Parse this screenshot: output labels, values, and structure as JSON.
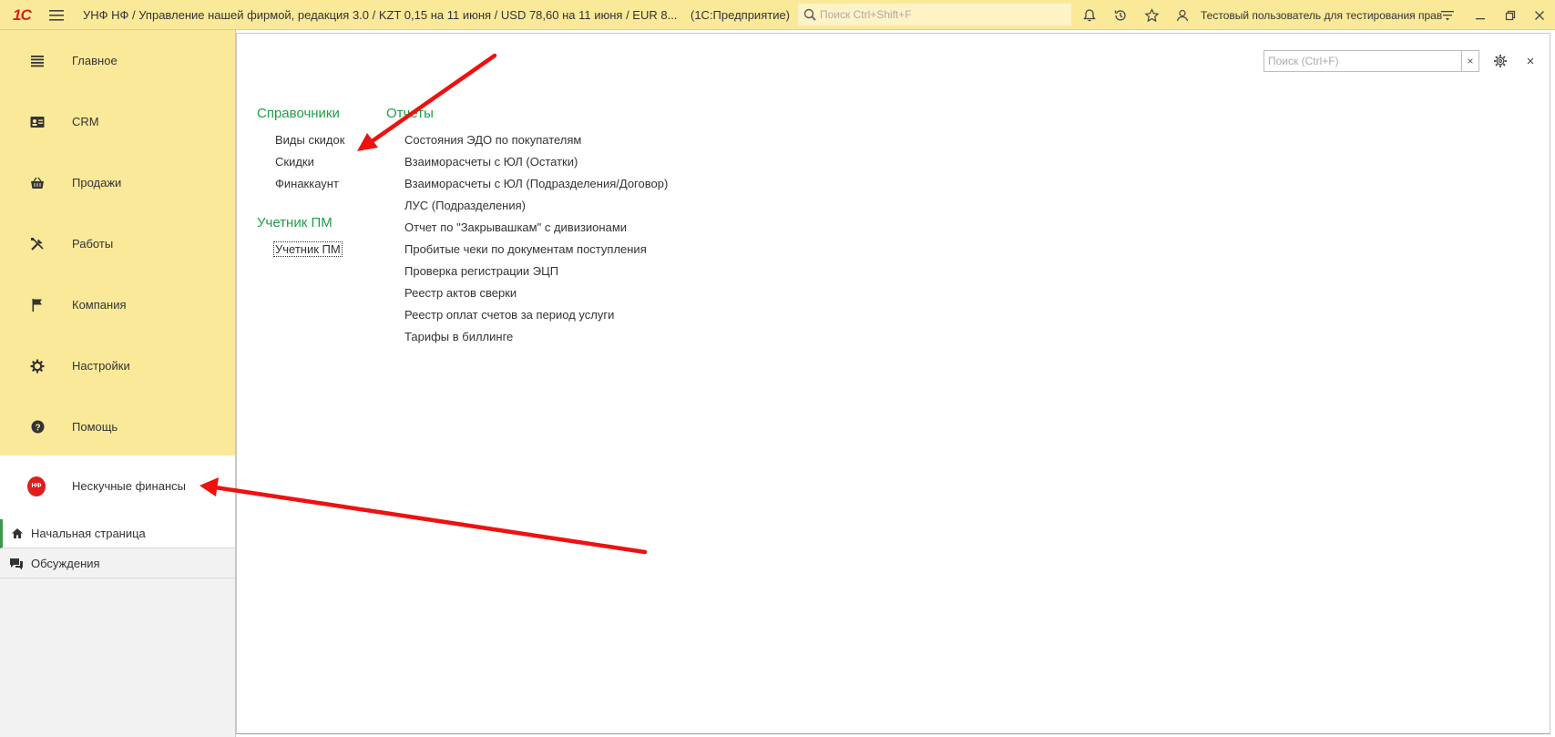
{
  "titlebar": {
    "logo": "1С",
    "title": "УНФ НФ / Управление нашей фирмой, редакция 3.0 / KZT 0,15 на 11 июня / USD 78,60 на 11 июня / EUR 8...",
    "platform": "(1С:Предприятие)",
    "search_placeholder": "Поиск Ctrl+Shift+F",
    "user": "Тестовый пользователь для тестирования прав"
  },
  "sidebar": {
    "sections": [
      {
        "label": "Главное",
        "icon": "main-menu-icon"
      },
      {
        "label": "CRM",
        "icon": "contact-card-icon"
      },
      {
        "label": "Продажи",
        "icon": "basket-icon"
      },
      {
        "label": "Работы",
        "icon": "tools-icon"
      },
      {
        "label": "Компания",
        "icon": "flag-icon"
      },
      {
        "label": "Настройки",
        "icon": "gear-icon"
      },
      {
        "label": "Помощь",
        "icon": "help-icon"
      }
    ],
    "active_section": {
      "label": "Нескучные финансы",
      "badge": "НФ"
    },
    "links": {
      "home": "Начальная страница",
      "discussions": "Обсуждения"
    }
  },
  "panel": {
    "search_placeholder": "Поиск (Ctrl+F)",
    "clear": "×",
    "close": "×",
    "groups": {
      "catalogs": {
        "title": "Справочники",
        "items": [
          "Виды скидок",
          "Скидки",
          "Финаккаунт"
        ]
      },
      "pm": {
        "title": "Учетник ПМ",
        "items": [
          "Учетник ПМ"
        ]
      },
      "reports": {
        "title": "Отчеты",
        "items": [
          "Состояния ЭДО по покупателям",
          "Взаиморасчеты с ЮЛ (Остатки)",
          "Взаиморасчеты с ЮЛ (Подразделения/Договор)",
          "ЛУС (Подразделения)",
          "Отчет по \"Закрывашкам\" с дивизионами",
          "Пробитые чеки по документам поступления",
          "Проверка регистрации ЭЦП",
          "Реестр актов сверки",
          "Реестр оплат счетов за период услуги",
          "Тарифы в биллинге"
        ]
      }
    }
  },
  "colors": {
    "accent_yellow": "#fbe99a",
    "group_title_green": "#1f9d47",
    "annotation_red": "#f01010",
    "badge_red": "#e01c1c"
  }
}
